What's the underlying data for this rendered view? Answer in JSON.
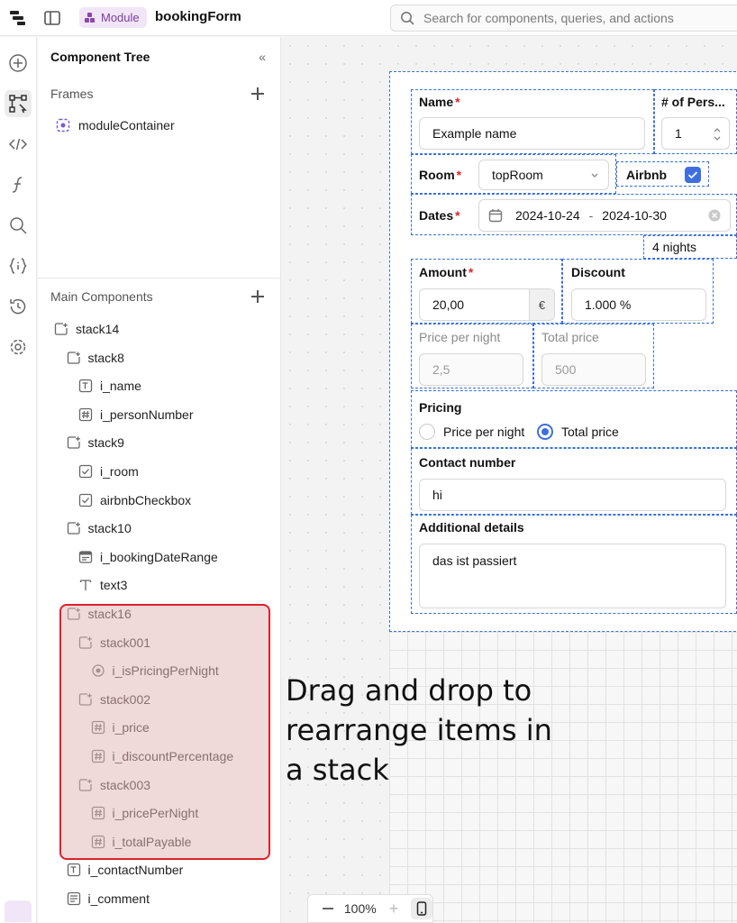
{
  "header": {
    "module_badge": "Module",
    "app_title": "bookingForm",
    "search_placeholder": "Search for components, queries, and actions"
  },
  "rail": {
    "icons": [
      "add-icon",
      "component-tree-icon",
      "code-icon",
      "function-icon",
      "search-icon",
      "state-icon",
      "history-icon",
      "settings-icon"
    ]
  },
  "tree": {
    "title": "Component Tree",
    "frames_label": "Frames",
    "frame_item": "moduleContainer",
    "main_label": "Main Components",
    "nodes": [
      {
        "label": "stack14",
        "type": "stack"
      },
      {
        "label": "stack8",
        "type": "stack"
      },
      {
        "label": "i_name",
        "type": "text-input"
      },
      {
        "label": "i_personNumber",
        "type": "number-input"
      },
      {
        "label": "stack9",
        "type": "stack"
      },
      {
        "label": "i_room",
        "type": "select"
      },
      {
        "label": "airbnbCheckbox",
        "type": "checkbox"
      },
      {
        "label": "stack10",
        "type": "stack"
      },
      {
        "label": "i_bookingDateRange",
        "type": "date-range"
      },
      {
        "label": "text3",
        "type": "text"
      },
      {
        "label": "stack16",
        "type": "stack"
      },
      {
        "label": "stack001",
        "type": "stack"
      },
      {
        "label": "i_isPricingPerNight",
        "type": "radio"
      },
      {
        "label": "stack002",
        "type": "stack"
      },
      {
        "label": "i_price",
        "type": "number-input"
      },
      {
        "label": "i_discountPercentage",
        "type": "number-input"
      },
      {
        "label": "stack003",
        "type": "stack"
      },
      {
        "label": "i_pricePerNight",
        "type": "number-input"
      },
      {
        "label": "i_totalPayable",
        "type": "number-input"
      },
      {
        "label": "i_contactNumber",
        "type": "text-input"
      },
      {
        "label": "i_comment",
        "type": "textarea"
      }
    ]
  },
  "form": {
    "name_label": "Name",
    "name_value": "Example name",
    "persons_label": "# of Pers...",
    "persons_value": "1",
    "room_label": "Room",
    "room_value": "topRoom",
    "airbnb_label": "Airbnb",
    "dates_label": "Dates",
    "date_start": "2024-10-24",
    "date_sep": "-",
    "date_end": "2024-10-30",
    "nights": "4 nights",
    "amount_label": "Amount",
    "amount_value": "20,00",
    "currency": "€",
    "discount_label": "Discount",
    "discount_value": "1.000 %",
    "ppn_label": "Price per night",
    "ppn_value": "2,5",
    "total_label": "Total price",
    "total_value": "500",
    "pricing_label": "Pricing",
    "pricing_opt1": "Price per night",
    "pricing_opt2": "Total price",
    "contact_label": "Contact number",
    "contact_value": "hi",
    "details_label": "Additional details",
    "details_value": "das ist passiert",
    "required_mark": "*"
  },
  "overlay": {
    "line1": "Drag and drop to",
    "line2": "rearrange items in",
    "line3": "a stack"
  },
  "zoom": {
    "value": "100%"
  },
  "colors": {
    "accent": "#3d6fe0",
    "module_badge_bg": "#f1e6f7",
    "highlight_border": "#e0202a"
  }
}
